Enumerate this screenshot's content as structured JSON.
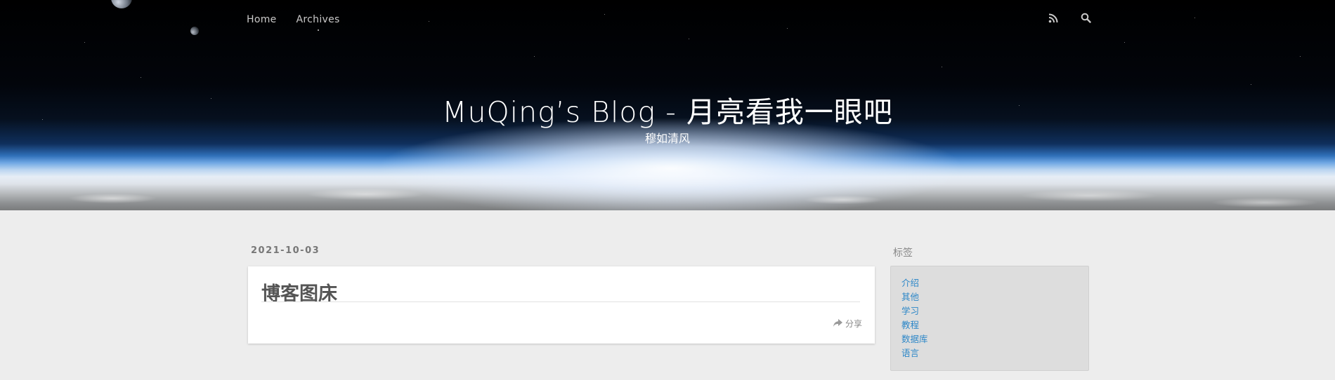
{
  "nav": {
    "items": [
      "Home",
      "Archives"
    ],
    "icons": [
      "rss-icon",
      "search-icon"
    ]
  },
  "header": {
    "title": "MuQing’s Blog - 月亮看我一眼吧",
    "subtitle": "穆如清风"
  },
  "post": {
    "date": "2021-10-03",
    "title": "博客图床",
    "share_label": "分享"
  },
  "sidebar": {
    "title": "标签",
    "tags": [
      "介绍",
      "其他",
      "学习",
      "教程",
      "数据库",
      "语言"
    ]
  },
  "colors": {
    "link": "#2d87c8",
    "page_bg": "#ededed",
    "card_bg": "#ffffff",
    "tag_box_bg": "#dddddd"
  }
}
